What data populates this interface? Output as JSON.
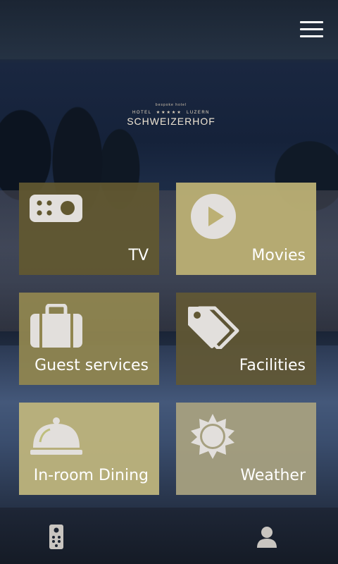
{
  "header": {
    "menu_icon": "hamburger-menu-icon"
  },
  "logo": {
    "tagline": "bespoke hotel",
    "left_text": "HOTEL",
    "stars": "★★★★★",
    "right_text": "LUZERN",
    "name": "SCHWEIZERHOF"
  },
  "tiles": [
    {
      "id": "tv",
      "label": "TV",
      "icon": "tv-remote-icon"
    },
    {
      "id": "movies",
      "label": "Movies",
      "icon": "play-icon"
    },
    {
      "id": "guest_services",
      "label": "Guest services",
      "icon": "suitcase-icon"
    },
    {
      "id": "facilities",
      "label": "Facilities",
      "icon": "tags-icon"
    },
    {
      "id": "in_room_dining",
      "label": "In-room Dining",
      "icon": "cloche-icon"
    },
    {
      "id": "weather",
      "label": "Weather",
      "icon": "sun-icon"
    }
  ],
  "bottom_bar": {
    "left_icon": "remote-control-icon",
    "right_icon": "user-profile-icon"
  },
  "colors": {
    "tile_dark_olive": "#625830",
    "tile_light_gold": "#bcb074",
    "tile_mid_olive": "#918650",
    "tile_sand": "#bebe7c",
    "tile_grey_khaki": "#a6a080",
    "icon_fill": "#e2dfdc",
    "bottom_icon": "#c9c5c0"
  }
}
